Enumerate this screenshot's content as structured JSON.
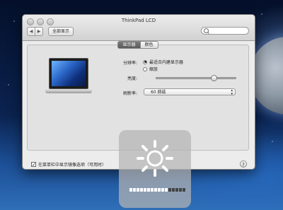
{
  "window": {
    "title": "ThinkPad LCD",
    "show_all": "全部显示",
    "tabs": [
      {
        "label": "显示器",
        "active": true
      },
      {
        "label": "颜色",
        "active": false
      }
    ]
  },
  "display": {
    "resolution_label": "分辨率:",
    "resolution_options": [
      {
        "label": "最适合内建显示器",
        "selected": true
      },
      {
        "label": "缩放",
        "selected": false
      }
    ],
    "brightness_label": "亮度:",
    "brightness_value": 0.72,
    "refresh_label": "刷新率:",
    "refresh_value": "60 赫兹"
  },
  "footer": {
    "mirror_checkbox_label": "在菜单栏中显示镜像选项（可用时）",
    "mirror_checked": true,
    "help": "?"
  },
  "hud": {
    "icon": "sun-icon",
    "level_filled": 11,
    "level_total": 16
  },
  "colors": {
    "tab_active": "#5a5a5a",
    "window_bg": "#ececec"
  }
}
